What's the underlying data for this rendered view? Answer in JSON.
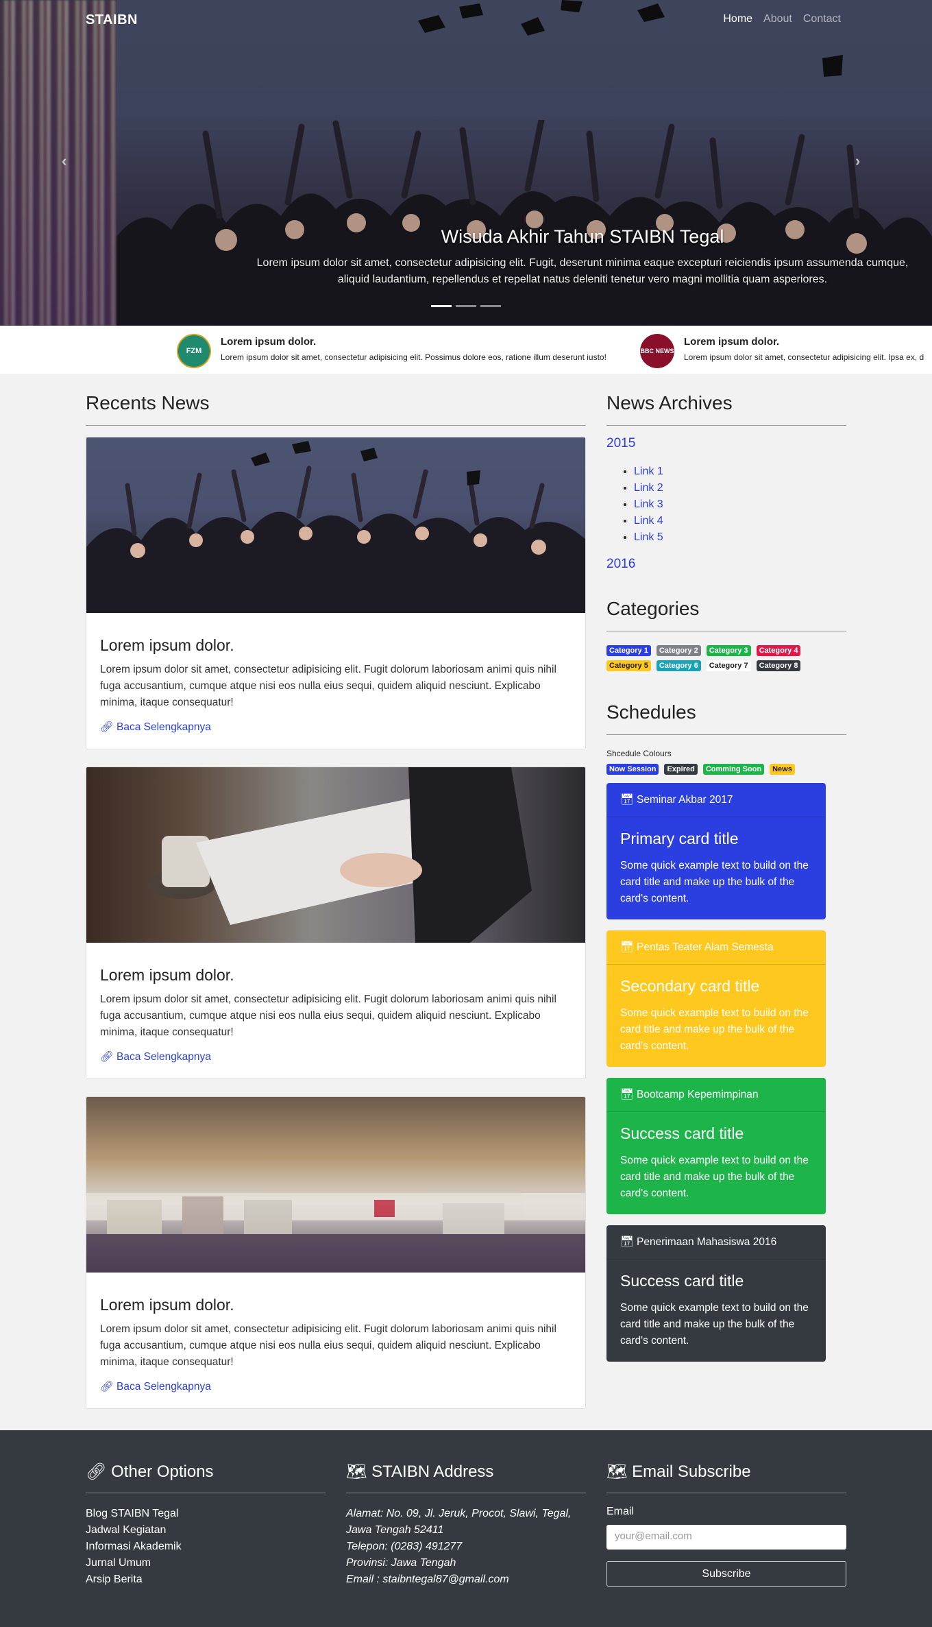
{
  "navbar": {
    "brand": "STAIBN",
    "links": [
      "Home",
      "About",
      "Contact"
    ]
  },
  "hero": {
    "title": "Wisuda Akhir Tahun STAIBN Tegal",
    "text": "Lorem ipsum dolor sit amet, consectetur adipisicing elit. Fugit, deserunt minima eaque excepturi reiciendis ipsum assumenda cumque, aliquid laudantium, repellendus et repellat natus deleniti tenetur vero magni mollitia quam asperiores.",
    "prev": "‹",
    "next": "›"
  },
  "ticker": [
    {
      "logo": "FZM",
      "title": "Lorem ipsum dolor.",
      "text": "Lorem ipsum dolor sit amet, consectetur adipisicing elit. Possimus dolore eos, ratione illum deserunt iusto!"
    },
    {
      "logo": "BBC NEWS",
      "title": "Lorem ipsum dolor.",
      "text": "Lorem ipsum dolor sit amet, consectetur adipisicing elit. Ipsa ex, d"
    }
  ],
  "recents": {
    "heading": "Recents News",
    "cards": [
      {
        "title": "Lorem ipsum dolor.",
        "text": "Lorem ipsum dolor sit amet, consectetur adipisicing elit. Fugit dolorum laboriosam animi quis nihil fuga accusantium, cumque atque nisi eos nulla eius sequi, quidem aliquid nesciunt. Explicabo minima, itaque consequatur!",
        "link": "Baca Selengkapnya"
      },
      {
        "title": "Lorem ipsum dolor.",
        "text": "Lorem ipsum dolor sit amet, consectetur adipisicing elit. Fugit dolorum laboriosam animi quis nihil fuga accusantium, cumque atque nisi eos nulla eius sequi, quidem aliquid nesciunt. Explicabo minima, itaque consequatur!",
        "link": "Baca Selengkapnya"
      },
      {
        "title": "Lorem ipsum dolor.",
        "text": "Lorem ipsum dolor sit amet, consectetur adipisicing elit. Fugit dolorum laboriosam animi quis nihil fuga accusantium, cumque atque nisi eos nulla eius sequi, quidem aliquid nesciunt. Explicabo minima, itaque consequatur!",
        "link": "Baca Selengkapnya"
      }
    ]
  },
  "archives": {
    "heading": "News Archives",
    "year1": "2015",
    "links": [
      "Link 1",
      "Link 2",
      "Link 3",
      "Link 4",
      "Link 5"
    ],
    "year2": "2016"
  },
  "categories": {
    "heading": "Categories",
    "items": [
      {
        "label": "Category 1",
        "color": "#2b3ee0"
      },
      {
        "label": "Category 2",
        "color": "#7d8288"
      },
      {
        "label": "Category 3",
        "color": "#1db44a"
      },
      {
        "label": "Category 4",
        "color": "#e0194b"
      },
      {
        "label": "Category 5",
        "color": "#ffc81f"
      },
      {
        "label": "Category 6",
        "color": "#17a2b8"
      },
      {
        "label": "Category 7",
        "color": "#ffffff"
      },
      {
        "label": "Category 8",
        "color": "#343a40"
      }
    ]
  },
  "schedules": {
    "heading": "Schedules",
    "legend_label": "Shcedule Colours",
    "legend": [
      {
        "label": "Now Session",
        "color": "#2b3ee0"
      },
      {
        "label": "Expired",
        "color": "#343a40"
      },
      {
        "label": "Comming Soon",
        "color": "#1db44a"
      },
      {
        "label": "News",
        "color": "#ffc81f"
      }
    ],
    "cards": [
      {
        "header": "Seminar Akbar 2017",
        "title": "Primary card title",
        "text": "Some quick example text to build on the card title and make up the bulk of the card's content.",
        "color": "#2b3ee0"
      },
      {
        "header": "Pentas Teater Alam Semesta",
        "title": "Secondary card title",
        "text": "Some quick example text to build on the card title and make up the bulk of the card's content.",
        "color": "#ffc81f"
      },
      {
        "header": "Bootcamp Kepemimpinan",
        "title": "Success card title",
        "text": "Some quick example text to build on the card title and make up the bulk of the card's content.",
        "color": "#1db44a"
      },
      {
        "header": "Penerimaan Mahasiswa 2016",
        "title": "Success card title",
        "text": "Some quick example text to build on the card title and make up the bulk of the card's content.",
        "color": "#343a40"
      }
    ]
  },
  "footer": {
    "options_heading": "Other Options",
    "options": [
      "Blog STAIBN Tegal",
      "Jadwal Kegiatan",
      "Informasi Akademik",
      "Jurnal Umum",
      "Arsip Berita"
    ],
    "address_heading": "STAIBN Address",
    "address": [
      "Alamat: No. 09, Jl. Jeruk, Procot, Slawi, Tegal,",
      "Jawa Tengah 52411",
      "Telepon: (0283) 491277",
      "Provinsi: Jawa Tengah",
      "Email : staibntegal87@gmail.com"
    ],
    "subscribe_heading": "Email Subscribe",
    "email_label": "Email",
    "email_placeholder": "your@email.com",
    "subscribe_button": "Subscribe"
  }
}
